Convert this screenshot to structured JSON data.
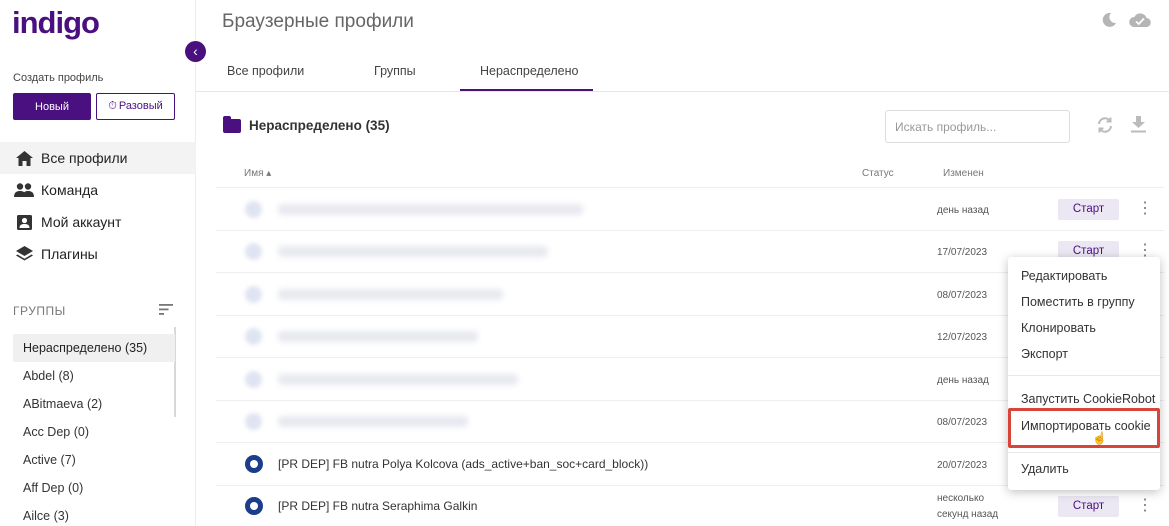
{
  "sidebar": {
    "logo": "indigo",
    "create_label": "Создать профиль",
    "new_button": "Новый",
    "once_button": "Разовый",
    "nav": [
      {
        "label": "Все профили",
        "icon": "home-icon"
      },
      {
        "label": "Команда",
        "icon": "team-icon"
      },
      {
        "label": "Мой аккаунт",
        "icon": "account-icon"
      },
      {
        "label": "Плагины",
        "icon": "layers-icon"
      }
    ],
    "groups_heading": "ГРУППЫ",
    "groups": [
      {
        "label": "Нераспределено",
        "count": "(35)"
      },
      {
        "label": "Abdel",
        "count": "(8)"
      },
      {
        "label": "ABitmaeva",
        "count": "(2)"
      },
      {
        "label": "Acc Dep",
        "count": "(0)"
      },
      {
        "label": "Active",
        "count": "(7)"
      },
      {
        "label": "Aff Dep",
        "count": "(0)"
      },
      {
        "label": "Ailce",
        "count": "(3)"
      }
    ]
  },
  "header": {
    "title": "Браузерные профили"
  },
  "tabs": [
    {
      "label": "Все профили"
    },
    {
      "label": "Группы"
    },
    {
      "label": "Нераспределено"
    }
  ],
  "content": {
    "folder_title": "Нераспределено (35)",
    "search_placeholder": "Искать профиль...",
    "columns": {
      "name": "Имя ▴",
      "status": "Статус",
      "changed": "Изменен"
    },
    "rows": [
      {
        "changed": "день назад",
        "start": "Старт"
      },
      {
        "changed": "17/07/2023",
        "start": "Старт"
      },
      {
        "changed": "08/07/2023"
      },
      {
        "changed": "12/07/2023"
      },
      {
        "changed": "день назад"
      },
      {
        "changed": "08/07/2023"
      },
      {
        "name": "[PR DEP] FB nutra Polya Kolcova (ads_active+ban_soc+card_block))",
        "changed": "20/07/2023"
      },
      {
        "name": "[PR DEP] FB nutra Seraphima Galkin",
        "changed_line1": "несколько",
        "changed_line2": "секунд назад",
        "start": "Старт"
      }
    ]
  },
  "context_menu": {
    "items": [
      "Редактировать",
      "Поместить в группу",
      "Клонировать",
      "Экспорт",
      "Запустить CookieRobot",
      "Импортировать cookie",
      "Удалить"
    ]
  },
  "colors": {
    "accent": "#4a1080",
    "highlight": "#d9443a"
  }
}
